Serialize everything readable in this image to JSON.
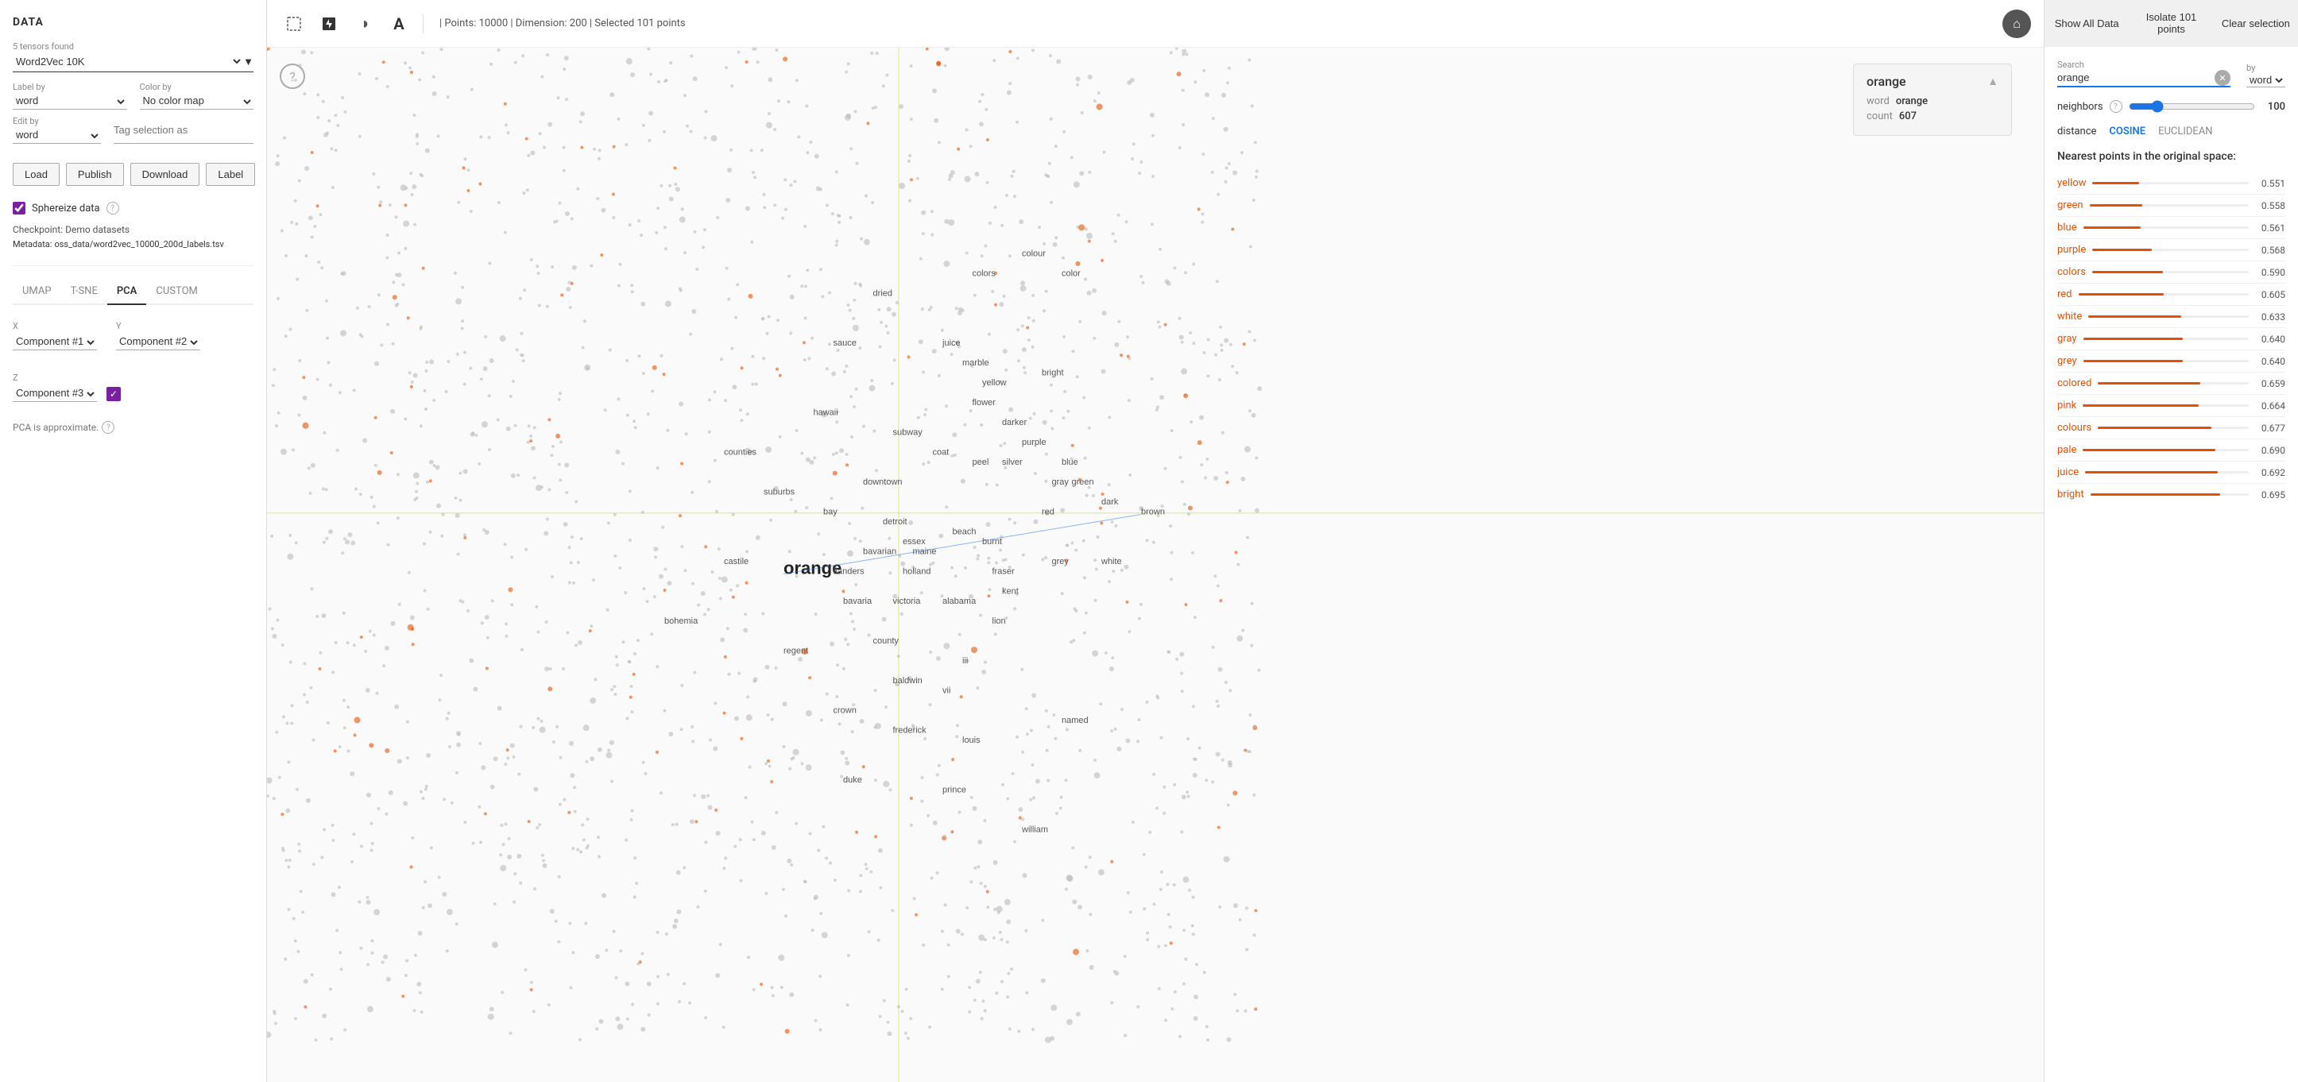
{
  "app": {
    "title": "DATA",
    "tensors_label": "5 tensors found",
    "selected_tensor": "Word2Vec 10K"
  },
  "left_panel": {
    "label_by_label": "Label by",
    "label_by_value": "word",
    "color_by_label": "Color by",
    "color_by_value": "No color map",
    "edit_by_label": "Edit by",
    "edit_by_value": "word",
    "tag_placeholder": "Tag selection as",
    "buttons": {
      "load": "Load",
      "publish": "Publish",
      "download": "Download",
      "label": "Label"
    },
    "sphereize_label": "Sphereize data",
    "checkpoint_label": "Checkpoint:",
    "checkpoint_value": "Demo datasets",
    "metadata_label": "Metadata:",
    "metadata_value": "oss_data/word2vec_10000_200d_labels.tsv"
  },
  "tabs": [
    "UMAP",
    "T-SNE",
    "PCA",
    "CUSTOM"
  ],
  "active_tab": "PCA",
  "pca": {
    "x_label": "X",
    "x_value": "Component #1",
    "y_label": "Y",
    "y_value": "Component #2",
    "z_label": "Z",
    "z_value": "Component #3",
    "approx_text": "PCA is approximate."
  },
  "toolbar": {
    "points_info": "| Points: 10000 | Dimension: 200 | Selected 101 points"
  },
  "tooltip": {
    "title": "orange",
    "word_label": "word",
    "word_value": "orange",
    "count_label": "count",
    "count_value": "607"
  },
  "right_panel": {
    "btn_show_all": "Show All Data",
    "btn_isolate": "Isolate 101 points",
    "btn_clear": "Clear selection",
    "search_label": "Search",
    "search_value": "orange",
    "by_label": "by",
    "by_value": "word",
    "neighbors_label": "neighbors",
    "neighbors_value": 100,
    "distance_label": "distance",
    "distance_cosine": "COSINE",
    "distance_euclidean": "EUCLIDEAN",
    "nearest_title": "Nearest points in the original space:",
    "nearest_points": [
      {
        "word": "yellow",
        "value": 0.551,
        "pct": 30
      },
      {
        "word": "green",
        "value": 0.558,
        "pct": 33
      },
      {
        "word": "blue",
        "value": 0.561,
        "pct": 35
      },
      {
        "word": "purple",
        "value": 0.568,
        "pct": 38
      },
      {
        "word": "colors",
        "value": 0.59,
        "pct": 45
      },
      {
        "word": "red",
        "value": 0.605,
        "pct": 50
      },
      {
        "word": "white",
        "value": 0.633,
        "pct": 58
      },
      {
        "word": "gray",
        "value": 0.64,
        "pct": 60
      },
      {
        "word": "grey",
        "value": 0.64,
        "pct": 60
      },
      {
        "word": "colored",
        "value": 0.659,
        "pct": 68
      },
      {
        "word": "pink",
        "value": 0.664,
        "pct": 70
      },
      {
        "word": "colours",
        "value": 0.677,
        "pct": 75
      },
      {
        "word": "pale",
        "value": 0.69,
        "pct": 80
      },
      {
        "word": "juice",
        "value": 0.692,
        "pct": 81
      },
      {
        "word": "bright",
        "value": 0.695,
        "pct": 82
      }
    ]
  },
  "scatter_words": [
    {
      "text": "orange",
      "x": 52,
      "y": 53,
      "size": 22,
      "bold": true
    },
    {
      "text": "colors",
      "x": 71,
      "y": 23,
      "size": 11
    },
    {
      "text": "colour",
      "x": 76,
      "y": 21,
      "size": 11
    },
    {
      "text": "color",
      "x": 80,
      "y": 23,
      "size": 11
    },
    {
      "text": "dried",
      "x": 61,
      "y": 25,
      "size": 11
    },
    {
      "text": "sauce",
      "x": 57,
      "y": 30,
      "size": 11
    },
    {
      "text": "juice",
      "x": 68,
      "y": 30,
      "size": 11
    },
    {
      "text": "marble",
      "x": 70,
      "y": 32,
      "size": 11
    },
    {
      "text": "yellow",
      "x": 72,
      "y": 34,
      "size": 11
    },
    {
      "text": "hawaii",
      "x": 55,
      "y": 37,
      "size": 11
    },
    {
      "text": "flower",
      "x": 71,
      "y": 36,
      "size": 11
    },
    {
      "text": "bright",
      "x": 78,
      "y": 33,
      "size": 11
    },
    {
      "text": "darker",
      "x": 74,
      "y": 38,
      "size": 11
    },
    {
      "text": "subway",
      "x": 63,
      "y": 39,
      "size": 11
    },
    {
      "text": "purple",
      "x": 76,
      "y": 40,
      "size": 11
    },
    {
      "text": "blue",
      "x": 80,
      "y": 42,
      "size": 11
    },
    {
      "text": "counties",
      "x": 46,
      "y": 41,
      "size": 11
    },
    {
      "text": "coat",
      "x": 67,
      "y": 41,
      "size": 11
    },
    {
      "text": "peel",
      "x": 71,
      "y": 42,
      "size": 11
    },
    {
      "text": "silver",
      "x": 74,
      "y": 42,
      "size": 11
    },
    {
      "text": "gray",
      "x": 79,
      "y": 44,
      "size": 11
    },
    {
      "text": "green",
      "x": 81,
      "y": 44,
      "size": 11
    },
    {
      "text": "suburbs",
      "x": 50,
      "y": 45,
      "size": 11
    },
    {
      "text": "downtown",
      "x": 60,
      "y": 44,
      "size": 11
    },
    {
      "text": "red",
      "x": 78,
      "y": 47,
      "size": 11
    },
    {
      "text": "dark",
      "x": 84,
      "y": 46,
      "size": 11
    },
    {
      "text": "brown",
      "x": 88,
      "y": 47,
      "size": 11
    },
    {
      "text": "bay",
      "x": 56,
      "y": 47,
      "size": 11
    },
    {
      "text": "beach",
      "x": 69,
      "y": 49,
      "size": 11
    },
    {
      "text": "detroit",
      "x": 62,
      "y": 48,
      "size": 11
    },
    {
      "text": "essex",
      "x": 64,
      "y": 50,
      "size": 11
    },
    {
      "text": "bavarian",
      "x": 60,
      "y": 51,
      "size": 11
    },
    {
      "text": "maine",
      "x": 65,
      "y": 51,
      "size": 11
    },
    {
      "text": "burnt",
      "x": 72,
      "y": 50,
      "size": 11
    },
    {
      "text": "castile",
      "x": 46,
      "y": 52,
      "size": 11
    },
    {
      "text": "flanders",
      "x": 57,
      "y": 53,
      "size": 11
    },
    {
      "text": "holland",
      "x": 64,
      "y": 53,
      "size": 11
    },
    {
      "text": "fraser",
      "x": 73,
      "y": 53,
      "size": 11
    },
    {
      "text": "grey",
      "x": 79,
      "y": 52,
      "size": 11
    },
    {
      "text": "white",
      "x": 84,
      "y": 52,
      "size": 11
    },
    {
      "text": "bavaria",
      "x": 58,
      "y": 56,
      "size": 11
    },
    {
      "text": "victoria",
      "x": 63,
      "y": 56,
      "size": 11
    },
    {
      "text": "alabama",
      "x": 68,
      "y": 56,
      "size": 11
    },
    {
      "text": "kent",
      "x": 74,
      "y": 55,
      "size": 11
    },
    {
      "text": "bohemia",
      "x": 40,
      "y": 58,
      "size": 11
    },
    {
      "text": "county",
      "x": 61,
      "y": 60,
      "size": 11
    },
    {
      "text": "lion",
      "x": 73,
      "y": 58,
      "size": 11
    },
    {
      "text": "regent",
      "x": 52,
      "y": 61,
      "size": 11
    },
    {
      "text": "iii",
      "x": 70,
      "y": 62,
      "size": 11
    },
    {
      "text": "baldwin",
      "x": 63,
      "y": 64,
      "size": 11
    },
    {
      "text": "vii",
      "x": 68,
      "y": 65,
      "size": 11
    },
    {
      "text": "crown",
      "x": 57,
      "y": 67,
      "size": 11
    },
    {
      "text": "frederick",
      "x": 63,
      "y": 69,
      "size": 11
    },
    {
      "text": "louis",
      "x": 70,
      "y": 70,
      "size": 11
    },
    {
      "text": "named",
      "x": 80,
      "y": 68,
      "size": 11
    },
    {
      "text": "duke",
      "x": 58,
      "y": 74,
      "size": 11
    },
    {
      "text": "prince",
      "x": 68,
      "y": 75,
      "size": 11
    },
    {
      "text": "william",
      "x": 76,
      "y": 79,
      "size": 11
    }
  ]
}
